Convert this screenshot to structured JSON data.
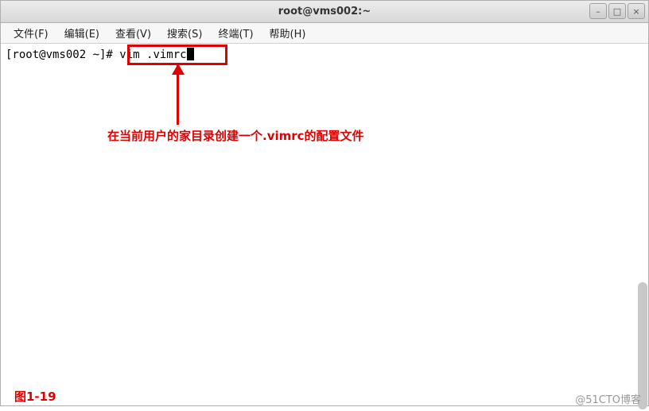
{
  "titlebar": {
    "title": "root@vms002:~"
  },
  "window_controls": {
    "minimize": "–",
    "maximize": "□",
    "close": "×"
  },
  "menubar": {
    "items": [
      "文件(F)",
      "编辑(E)",
      "查看(V)",
      "搜索(S)",
      "终端(T)",
      "帮助(H)"
    ]
  },
  "terminal": {
    "prompt": "[root@vms002 ~]# ",
    "command": "vim .vimrc"
  },
  "annotation": {
    "text": "在当前用户的家目录创建一个.vimrc的配置文件"
  },
  "figure_label": "图1-19",
  "watermark": "@51CTO博客"
}
